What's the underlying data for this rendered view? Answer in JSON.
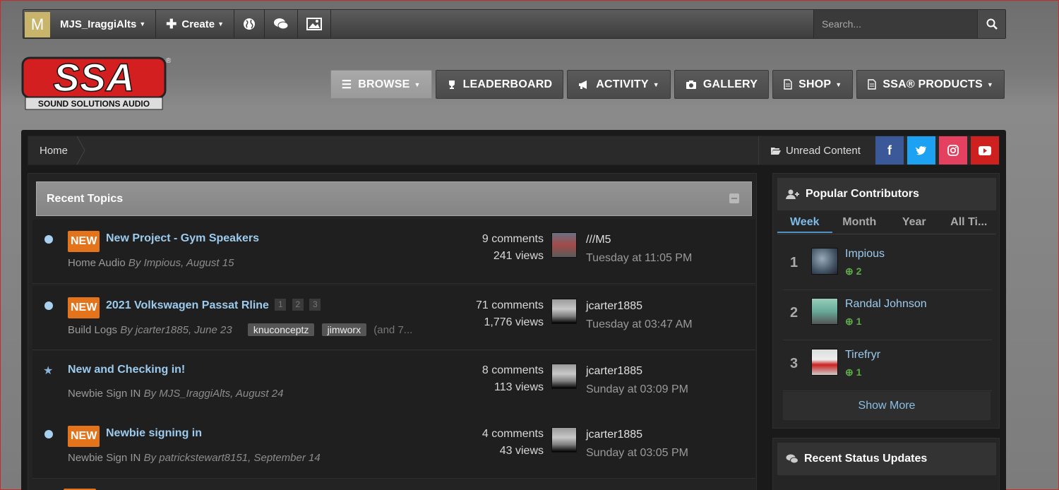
{
  "userbar": {
    "avatar_letter": "M",
    "username": "MJS_IraggiAlts",
    "create_label": "Create",
    "search_placeholder": "Search..."
  },
  "logo": {
    "text": "SSA",
    "tagline": "SOUND SOLUTIONS AUDIO",
    "registered": "®"
  },
  "nav": [
    {
      "label": "BROWSE",
      "icon": "list-icon",
      "caret": true,
      "active": true
    },
    {
      "label": "LEADERBOARD",
      "icon": "trophy-icon",
      "caret": false,
      "active": false
    },
    {
      "label": "ACTIVITY",
      "icon": "megaphone-icon",
      "caret": true,
      "active": false
    },
    {
      "label": "GALLERY",
      "icon": "camera-icon",
      "caret": false,
      "active": false
    },
    {
      "label": "SHOP",
      "icon": "document-icon",
      "caret": true,
      "active": false
    },
    {
      "label": "SSA® PRODUCTS",
      "icon": "document-icon",
      "caret": true,
      "active": false
    }
  ],
  "breadcrumb": {
    "home": "Home",
    "unread": "Unread Content"
  },
  "social": {
    "facebook": {
      "glyph": "f",
      "color": "#3b5998"
    },
    "twitter": {
      "glyph": "t",
      "color": "#1da1f2"
    },
    "instagram": {
      "glyph": "◎",
      "color": "#e4405f"
    },
    "youtube": {
      "glyph": "▶",
      "color": "#cd201f"
    }
  },
  "topics": {
    "heading": "Recent Topics",
    "new_badge": "NEW",
    "rows": [
      {
        "title": "New Project - Gym Speakers",
        "forum": "Home Audio",
        "byline": "By Impious, August 15",
        "comments": "9 comments",
        "views": "241 views",
        "last_user": "///M5",
        "last_time": "Tuesday at 11:05 PM"
      },
      {
        "title": "2021 Volkswagen Passat Rline",
        "pages": [
          "1",
          "2",
          "3"
        ],
        "forum": "Build Logs",
        "byline": "By jcarter1885, June 23",
        "tags": [
          "knuconceptz",
          "jimworx"
        ],
        "tags_more": "(and 7...",
        "comments": "71 comments",
        "views": "1,776 views",
        "last_user": "jcarter1885",
        "last_time": "Tuesday at 03:47 AM"
      },
      {
        "title": "New and Checking in!",
        "forum": "Newbie Sign IN",
        "byline": "By MJS_IraggiAlts, August 24",
        "comments": "8 comments",
        "views": "113 views",
        "last_user": "jcarter1885",
        "last_time": "Sunday at 03:09 PM"
      },
      {
        "title": "Newbie signing in",
        "forum": "Newbie Sign IN",
        "byline": "By patrickstewart8151, September 14",
        "comments": "4 comments",
        "views": "43 views",
        "last_user": "jcarter1885",
        "last_time": "Sunday at 03:05 PM"
      }
    ]
  },
  "contributors": {
    "heading": "Popular Contributors",
    "tabs": [
      "Week",
      "Month",
      "Year",
      "All Ti..."
    ],
    "list": [
      {
        "rank": "1",
        "name": "Impious",
        "rep": "2"
      },
      {
        "rank": "2",
        "name": "Randal Johnson",
        "rep": "1"
      },
      {
        "rank": "3",
        "name": "Tirefryr",
        "rep": "1"
      }
    ],
    "show_more": "Show More"
  },
  "status_updates": {
    "heading": "Recent Status Updates"
  }
}
